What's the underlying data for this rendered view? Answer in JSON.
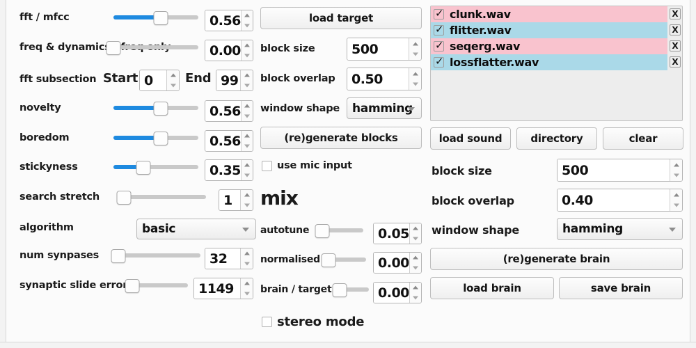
{
  "window": {
    "title_fragment": ""
  },
  "left_panel": {
    "rows": [
      {
        "label": "fft / mfcc",
        "control": "slider",
        "value": "0.56",
        "fraction": 0.56
      },
      {
        "label": "freq & dynamics / freq only",
        "control": "slider",
        "value": "0.00",
        "fraction": 0.0
      },
      {
        "label": "fft subsection",
        "control": "start_end",
        "start_label": "Start",
        "start_value": "0",
        "end_label": "End",
        "end_value": "99"
      },
      {
        "label": "novelty",
        "control": "slider",
        "value": "0.56",
        "fraction": 0.56
      },
      {
        "label": "boredom",
        "control": "slider",
        "value": "0.56",
        "fraction": 0.56
      },
      {
        "label": "stickyness",
        "control": "slider",
        "value": "0.35",
        "fraction": 0.35
      },
      {
        "label": "search stretch",
        "control": "slider",
        "value": "1",
        "fraction": 0.02
      },
      {
        "label": "algorithm",
        "control": "combo",
        "value": "basic"
      },
      {
        "label": "num synpases",
        "control": "slider",
        "value": "32",
        "fraction": 0.03
      },
      {
        "label": "synaptic slide error",
        "control": "slider",
        "value": "1149",
        "fraction": 0.05
      }
    ]
  },
  "middle_panel": {
    "load_target_button": "load target",
    "block_size_label": "block size",
    "block_size_value": "500",
    "block_overlap_label": "block overlap",
    "block_overlap_value": "0.50",
    "window_shape_label": "window shape",
    "window_shape_value": "hamming",
    "regenerate_blocks_button": "(re)generate blocks",
    "use_mic_input_label": "use mic input",
    "use_mic_input_checked": false,
    "mix_heading": "mix",
    "mix_rows": [
      {
        "label": "autotune",
        "value": "0.05",
        "fraction": 0.05
      },
      {
        "label": "normalised",
        "value": "0.00",
        "fraction": 0.0
      },
      {
        "label": "brain / target",
        "value": "0.00",
        "fraction": 0.0
      }
    ],
    "stereo_mode_label": "stereo mode",
    "stereo_mode_checked": false
  },
  "right_panel": {
    "files": [
      {
        "name": "clunk.wav",
        "checked": true,
        "color": "#f9c3ce",
        "delete_label": "X"
      },
      {
        "name": "flitter.wav",
        "checked": true,
        "color": "#aad9e8",
        "delete_label": "X"
      },
      {
        "name": "seqerg.wav",
        "checked": true,
        "color": "#f9c3ce",
        "delete_label": "X"
      },
      {
        "name": "lossflatter.wav",
        "checked": true,
        "color": "#aad9e8",
        "delete_label": "X"
      }
    ],
    "buttons": [
      "load sound",
      "directory",
      "clear"
    ],
    "block_size_label": "block size",
    "block_size_value": "500",
    "block_overlap_label": "block overlap",
    "block_overlap_value": "0.40",
    "window_shape_label": "window shape",
    "window_shape_value": "hamming",
    "regenerate_brain_button": "(re)generate brain",
    "load_brain_button": "load brain",
    "save_brain_button": "save brain"
  },
  "colors": {
    "slider_fill": "#1e8ae0",
    "row_pink": "#f9c3ce",
    "row_blue": "#aad9e8",
    "panel_bg": "#fbfbfb"
  }
}
